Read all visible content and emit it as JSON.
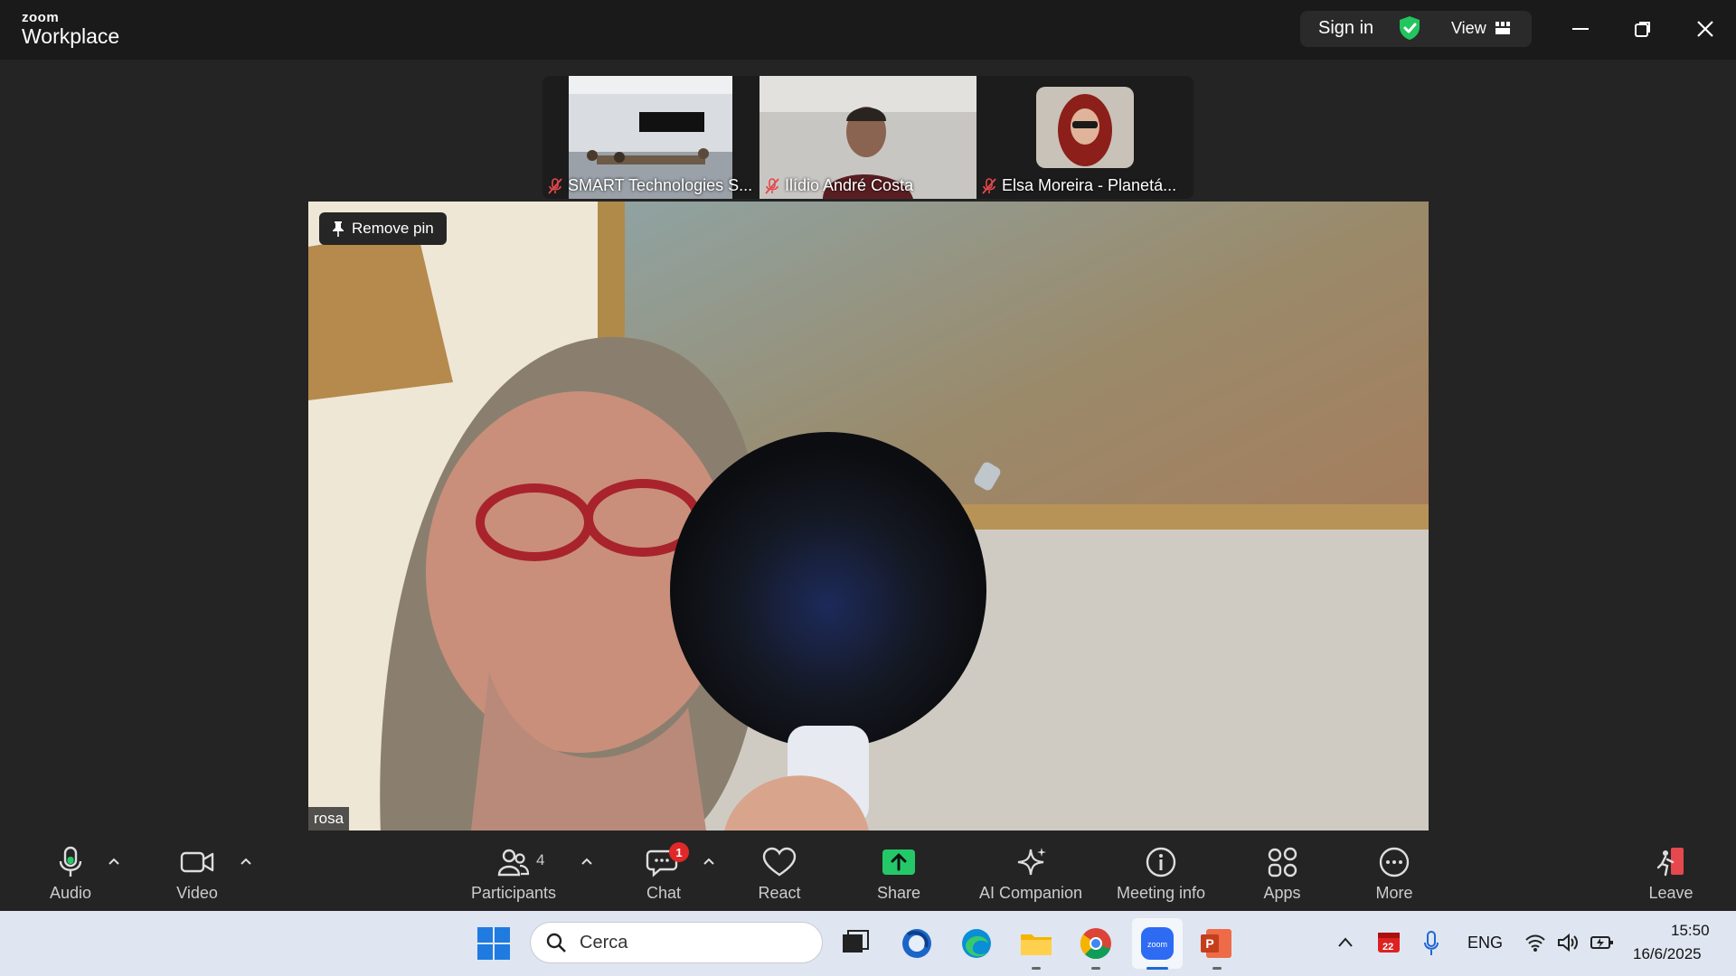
{
  "app": {
    "brand_small": "zoom",
    "brand_big": "Workplace"
  },
  "titlebar": {
    "sign_in": "Sign in",
    "view": "View"
  },
  "thumbnails": [
    {
      "name": "SMART Technologies S..."
    },
    {
      "name": "Ilídio André Costa"
    },
    {
      "name": "Elsa Moreira - Planetá..."
    }
  ],
  "main_video": {
    "pin_label": "Remove pin",
    "speaker": "rosa"
  },
  "toolbar": {
    "audio": "Audio",
    "video": "Video",
    "participants": "Participants",
    "participants_count": "4",
    "chat": "Chat",
    "chat_badge": "1",
    "react": "React",
    "share": "Share",
    "ai_companion": "AI Companion",
    "meeting_info": "Meeting info",
    "apps": "Apps",
    "more": "More",
    "leave": "Leave"
  },
  "taskbar": {
    "search_placeholder": "Cerca",
    "calendar_day": "22",
    "lang": "ENG",
    "time": "15:50",
    "date": "16/6/2025"
  },
  "colors": {
    "share_green": "#24c868",
    "shield_green": "#22c55e",
    "badge_red": "#e02828",
    "leave_red": "#e5484d"
  }
}
